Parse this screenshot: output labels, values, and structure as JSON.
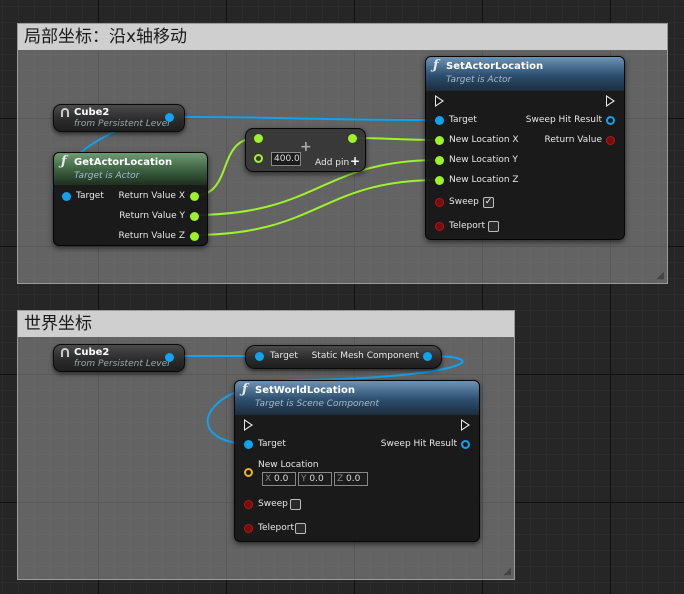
{
  "local_comment": {
    "title": "局部坐标：沿x轴移动"
  },
  "world_comment": {
    "title": "世界坐标"
  },
  "cube_var_1": {
    "title": "Cube2",
    "subtitle": "from Persistent Level"
  },
  "cube_var_2": {
    "title": "Cube2",
    "subtitle": "from Persistent Level"
  },
  "get_actor_location": {
    "title": "GetActorLocation",
    "subtitle": "Target is Actor",
    "target_label": "Target",
    "out_x": "Return Value X",
    "out_y": "Return Value Y",
    "out_z": "Return Value Z"
  },
  "add_node": {
    "value": "400.0",
    "add_pin_label": "Add pin",
    "plus_icon": "plus-icon"
  },
  "set_actor_location": {
    "title": "SetActorLocation",
    "subtitle": "Target is Actor",
    "target_label": "Target",
    "sweep_hit_label": "Sweep Hit Result",
    "return_value_label": "Return Value",
    "loc_x_label": "New Location X",
    "loc_y_label": "New Location Y",
    "loc_z_label": "New Location Z",
    "sweep_label": "Sweep",
    "sweep_checked": true,
    "teleport_label": "Teleport",
    "teleport_checked": false
  },
  "static_mesh_node": {
    "target_label": "Target",
    "output_label": "Static Mesh Component"
  },
  "set_world_location": {
    "title": "SetWorldLocation",
    "subtitle": "Target is Scene Component",
    "target_label": "Target",
    "sweep_hit_label": "Sweep Hit Result",
    "new_location_label": "New Location",
    "x_axis": "X",
    "x_value": "0.0",
    "y_axis": "Y",
    "y_value": "0.0",
    "z_axis": "Z",
    "z_value": "0.0",
    "sweep_label": "Sweep",
    "sweep_checked": false,
    "teleport_label": "Teleport",
    "teleport_checked": false
  },
  "colors": {
    "object_pin": "#0fa3f0",
    "float_pin": "#9ef22a",
    "bool_pin": "#8a1010",
    "vector_pin": "#f0b020",
    "function_header": "#2d4e6e",
    "pure_header": "#3a5f3f"
  }
}
